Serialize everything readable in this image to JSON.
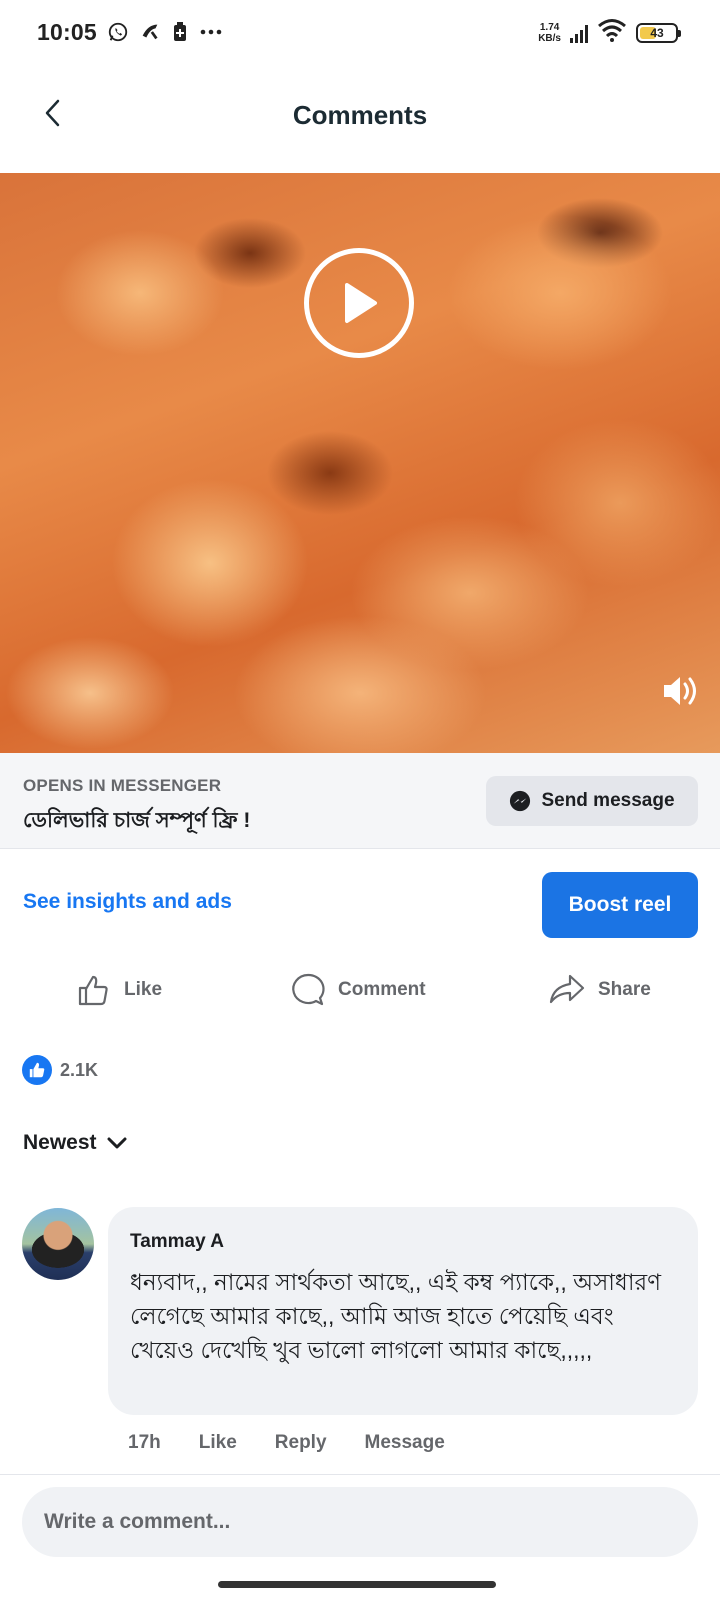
{
  "status_bar": {
    "time": "10:05",
    "left_icons": [
      "whatsapp-icon",
      "phone-icon",
      "sim-icon",
      "more-icon"
    ],
    "net_speed_value": "1.74",
    "net_speed_unit": "KB/s",
    "battery_level": "43"
  },
  "header": {
    "title": "Comments",
    "back_icon": "chevron-left-icon"
  },
  "video": {
    "play_icon": "play-icon",
    "volume_icon": "volume-icon"
  },
  "messenger_cta": {
    "label": "OPENS IN MESSENGER",
    "text": "ডেলিভারি চার্জ সম্পূর্ণ ফ্রি !",
    "button_label": "Send message",
    "button_icon": "messenger-icon"
  },
  "promo": {
    "insights_link": "See insights and ads",
    "boost_button": "Boost reel",
    "accent_color": "#1877f2"
  },
  "actions": {
    "like": "Like",
    "comment": "Comment",
    "share": "Share"
  },
  "reactions": {
    "count": "2.1K",
    "icon": "thumbs-up-icon"
  },
  "sort": {
    "label": "Newest"
  },
  "comment": {
    "author": "Tammay A",
    "text": "ধন্যবাদ,, নামের সার্থকতা আছে,, এই কম্ব প্যাকে,, অসাধারণ লেগেছে আমার কাছে,, আমি আজ হাতে পেয়েছি এবং খেয়েও দেখেছি খুব ভালো লাগলো আমার কাছে,,,,,",
    "time": "17h",
    "like": "Like",
    "reply": "Reply",
    "message": "Message"
  },
  "composer": {
    "placeholder": "Write a comment..."
  }
}
